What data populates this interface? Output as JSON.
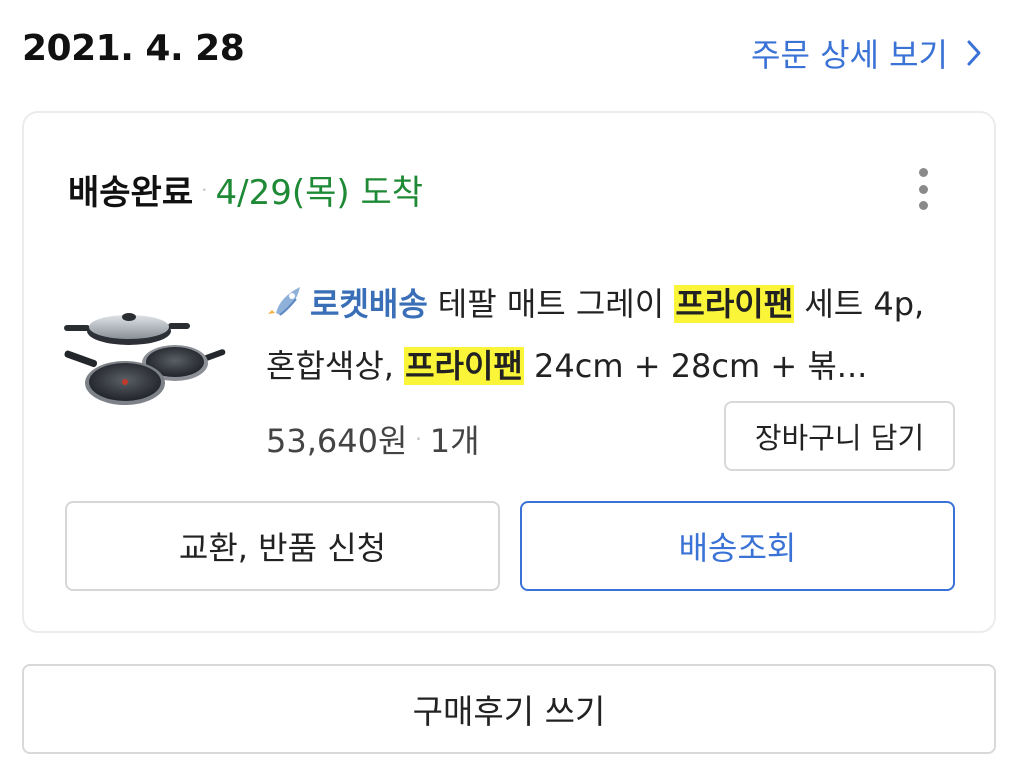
{
  "order": {
    "date": "2021. 4. 28",
    "detail_link_label": "주문 상세 보기"
  },
  "shipment": {
    "status": "배송완료",
    "separator": "·",
    "arrival": "4/29(목) 도착",
    "more_icon": "more-vertical-icon"
  },
  "product": {
    "image": "frying-pan-set-thumbnail",
    "rocket_icon": "rocket-icon",
    "badge": "로켓배송",
    "title_parts": [
      "테팔 매트 그레이 ",
      "프라이팬",
      " 세트 4p, 혼합색상, ",
      "프라이팬",
      " 24cm + 28cm + 볶..."
    ],
    "price": "53,640원",
    "separator": "·",
    "quantity": "1개",
    "cart_button_label": "장바구니 담기"
  },
  "actions": {
    "return_label": "교환, 반품 신청",
    "track_label": "배송조회",
    "review_label": "구매후기 쓰기"
  },
  "colors": {
    "link_blue": "#3a72d6",
    "arrival_green": "#1f8a36",
    "highlight_yellow": "#fbf53a",
    "rocket_blue": "#3a6fb8"
  }
}
